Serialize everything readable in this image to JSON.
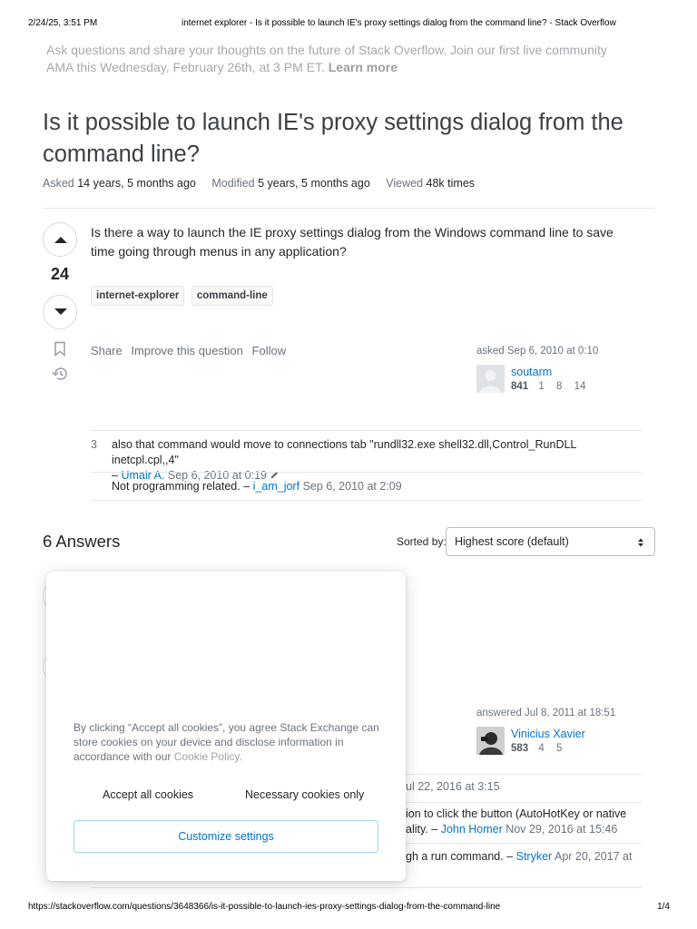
{
  "print_header": {
    "datetime": "2/24/25, 3:51 PM",
    "page_title": "internet explorer - Is it possible to launch IE's proxy settings dialog from the command line? - Stack Overflow"
  },
  "announcement": {
    "text": "Ask questions and share your thoughts on the future of Stack Overflow. Join our first live community AMA this Wednesday, February 26th, at 3 PM ET.",
    "link": "Learn more"
  },
  "question": {
    "title": "Is it possible to launch IE's proxy settings dialog from the command line?",
    "meta": {
      "asked_label": "Asked",
      "asked_value": "14 years, 5 months ago",
      "modified_label": "Modified",
      "modified_value": "5 years, 5 months ago",
      "viewed_label": "Viewed",
      "viewed_value": "48k times"
    },
    "vote_count": "24",
    "body": "Is there a way to launch the IE proxy settings dialog from the Windows command line to save time going through menus in any application?",
    "tags": [
      "internet-explorer",
      "command-line"
    ],
    "menu": {
      "share": "Share",
      "improve": "Improve this question",
      "follow": "Follow"
    },
    "author": {
      "action": "asked Sep 6, 2010 at 0:10",
      "name": "soutarm",
      "reputation": "841",
      "gold": "1",
      "silver": "8",
      "bronze": "14"
    },
    "comments": [
      {
        "score": "3",
        "text": "also that command would move to connections tab \"rundll32.exe shell32.dll,Control_RunDLL inetcpl.cpl,,4\"",
        "dash": "–",
        "user": "Umair A.",
        "date": "Sep 6, 2010 at 0:19"
      },
      {
        "score": "",
        "text": "Not programming related.",
        "dash": "–",
        "user": "i_am_jorf",
        "date": "Sep 6, 2010 at 2:09"
      }
    ]
  },
  "answers": {
    "heading": "6 Answers",
    "sort_label": "Sorted by:",
    "sort_value": "Highest score (default)",
    "first_answer_author": {
      "action": "answered Jul 8, 2011 at 18:51",
      "name": "Vinicius Xavier",
      "reputation": "583",
      "silver": "4",
      "bronze": "5"
    },
    "partial_comments": [
      {
        "text": "ul 22, 2016 at 3:15"
      },
      {
        "text_line1": "ion to click the button (AutoHotKey or native",
        "text_line2_pre": "ality. –",
        "user": "John Homer",
        "date": "Nov 29, 2016 at 15:46"
      },
      {
        "text_pre": "gh a run command. –",
        "user": "Stryker",
        "date": "Apr 20, 2017 at"
      }
    ]
  },
  "cookie_banner": {
    "text": "By clicking “Accept all cookies”, you agree Stack Exchange can store cookies on your device and disclose information in accordance with our",
    "policy_link": "Cookie Policy.",
    "accept_all": "Accept all cookies",
    "necessary_only": "Necessary cookies only",
    "customize": "Customize settings"
  },
  "print_footer": {
    "url": "https://stackoverflow.com/questions/3648366/is-it-possible-to-launch-ies-proxy-settings-dialog-from-the-command-line",
    "page": "1/4"
  },
  "colors": {
    "link": "#0074cc",
    "muted": "#6a737c",
    "border": "#e3e6e8",
    "customize_border": "#9fd0f7"
  }
}
